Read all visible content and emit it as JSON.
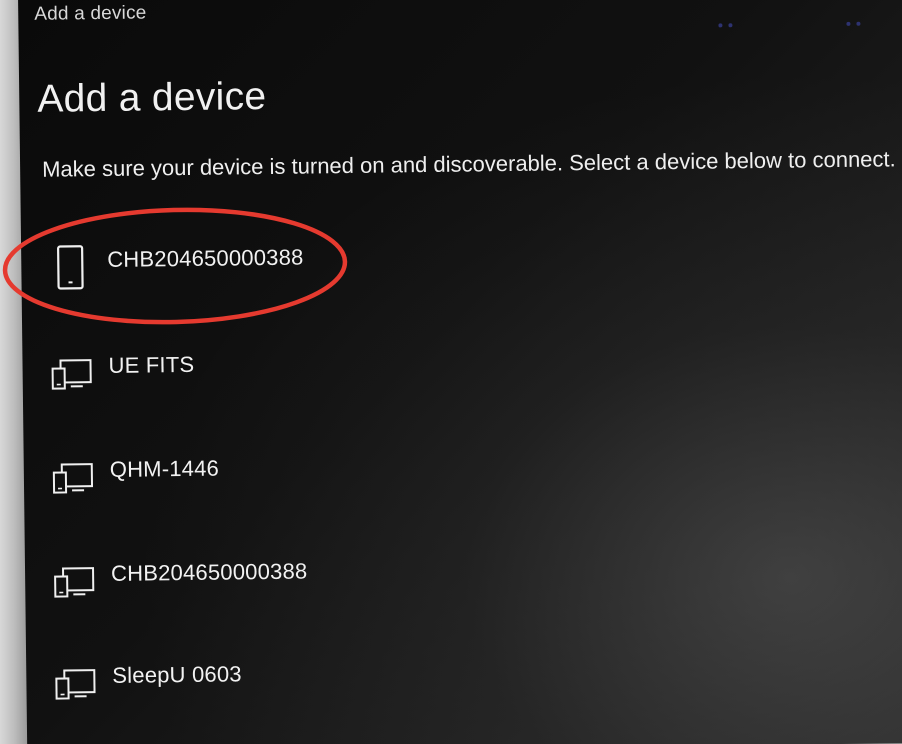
{
  "window": {
    "title": "Add a device"
  },
  "page": {
    "heading": "Add a device",
    "instructions": "Make sure your device is turned on and discoverable. Select a device below to connect."
  },
  "devices": [
    {
      "name": "CHB204650000388",
      "icon": "phone-icon",
      "highlighted": true
    },
    {
      "name": "UE FITS",
      "icon": "display-device-icon",
      "highlighted": false
    },
    {
      "name": "QHM-1446",
      "icon": "display-device-icon",
      "highlighted": false
    },
    {
      "name": "CHB204650000388",
      "icon": "display-device-icon",
      "highlighted": false
    },
    {
      "name": "SleepU 0603",
      "icon": "display-device-icon",
      "highlighted": false
    }
  ],
  "colors": {
    "background": "#0f0f0f",
    "text": "#f1f1f1",
    "highlight_oval": "#e53a2f"
  }
}
